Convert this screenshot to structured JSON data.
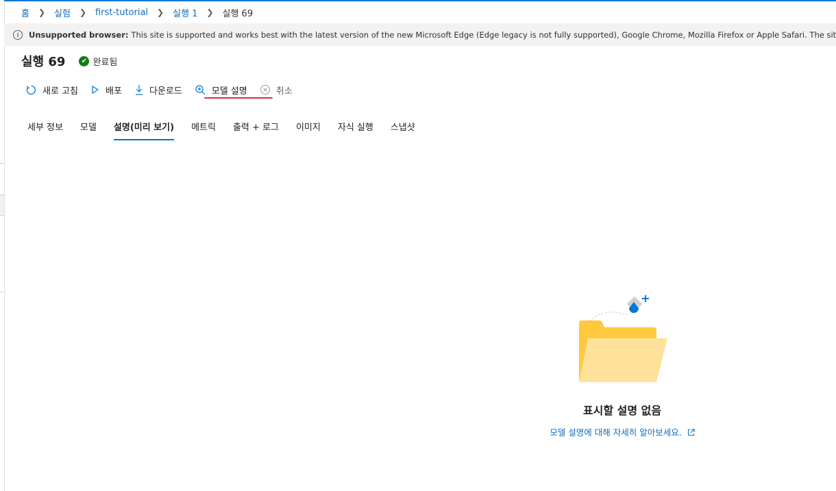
{
  "breadcrumb": [
    {
      "label": "홈"
    },
    {
      "label": "실험"
    },
    {
      "label": "first-tutorial"
    },
    {
      "label": "실행 1"
    },
    {
      "label": "실행 69"
    }
  ],
  "banner": {
    "bold": "Unsupported browser:",
    "text": "This site is supported and works best with the latest version of the new Microsoft Edge (Edge legacy is not fully supported), Google Chrome, Mozilla Firefox or Apple Safari. The site may not work correctly"
  },
  "header": {
    "title": "실행 69",
    "status": "완료됨",
    "status_color": "#107c10"
  },
  "toolbar": {
    "refresh": "새로 고침",
    "deploy": "배포",
    "download": "다운로드",
    "explain_model": "모델 설명",
    "cancel": "취소"
  },
  "tabs": [
    {
      "label": "세부 정보"
    },
    {
      "label": "모델"
    },
    {
      "label": "설명(미리 보기)",
      "active": true
    },
    {
      "label": "메트릭"
    },
    {
      "label": "출력 + 로그"
    },
    {
      "label": "이미지"
    },
    {
      "label": "자식 실행"
    },
    {
      "label": "스냅샷"
    }
  ],
  "empty_state": {
    "title": "표시할 설명 없음",
    "link": "모델 설명에 대해 자세히 알아보세요."
  },
  "colors": {
    "accent": "#0078d4",
    "highlight_underline": "#d13438",
    "folder": "#ffc83d"
  }
}
